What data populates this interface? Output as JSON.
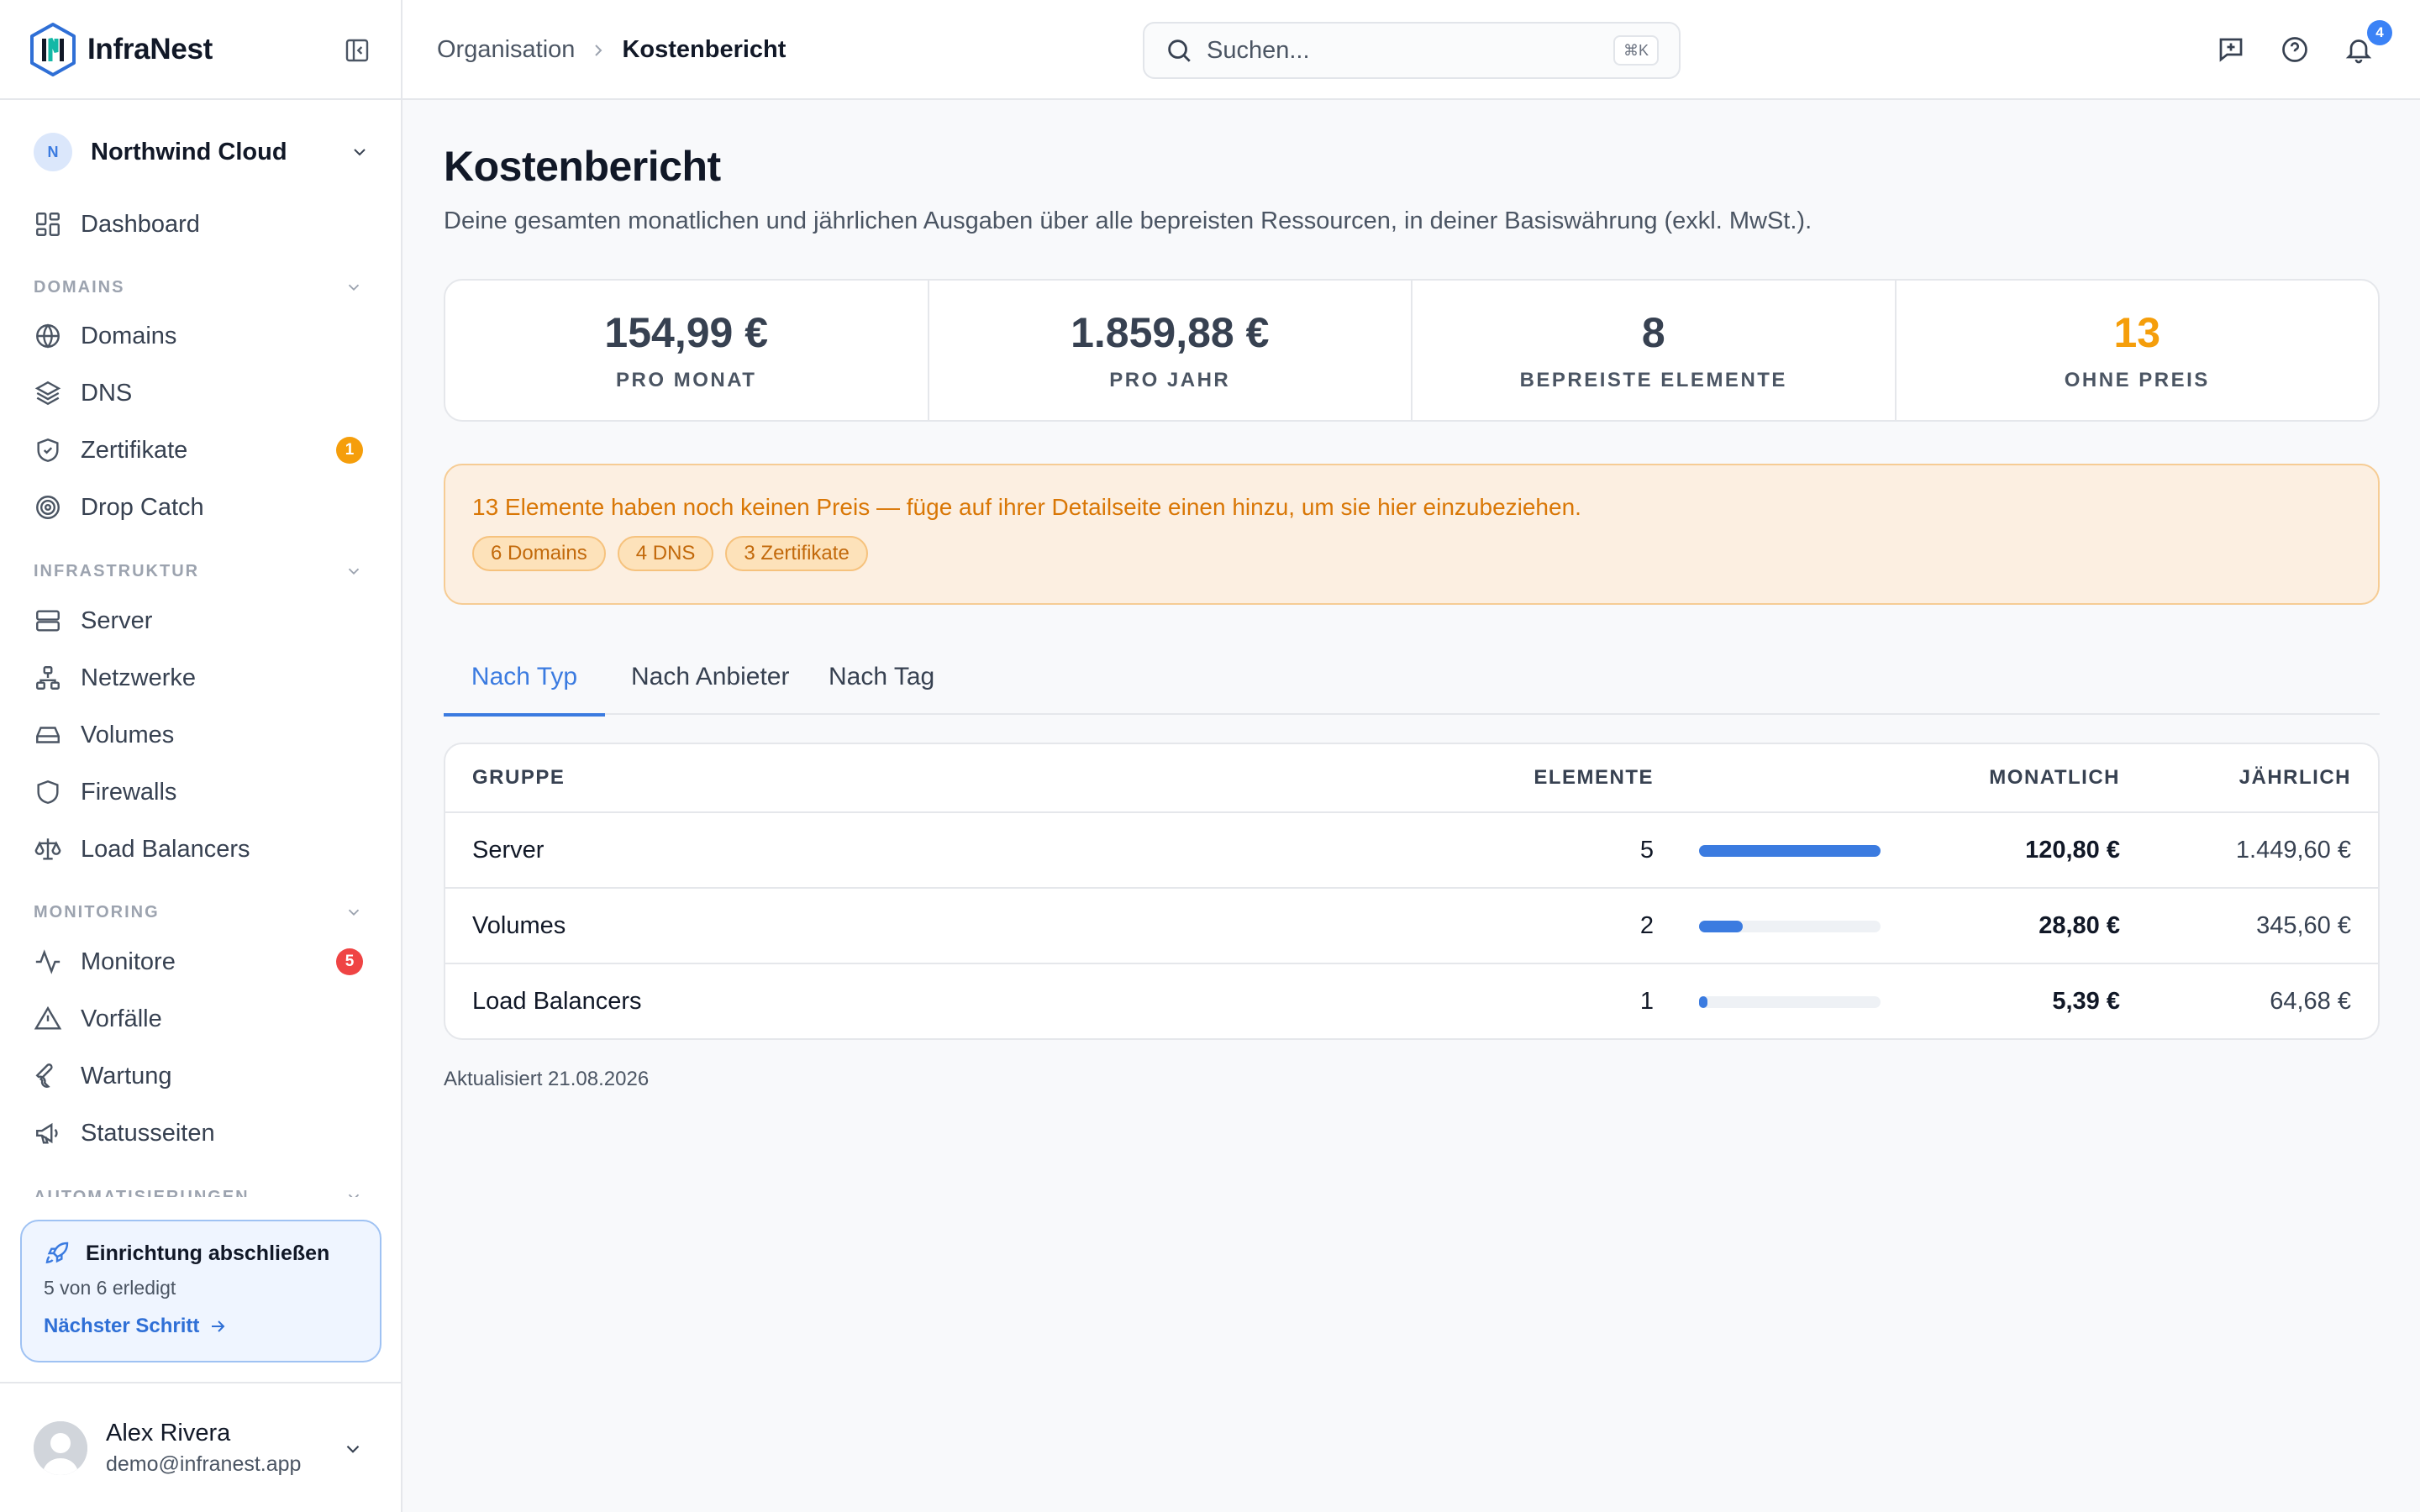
{
  "app": {
    "name": "InfraNest"
  },
  "org": {
    "initial": "N",
    "name": "Northwind Cloud"
  },
  "nav": {
    "dashboard": "Dashboard",
    "sections": {
      "domains": "DOMAINS",
      "infrastructure": "INFRASTRUKTUR",
      "monitoring": "MONITORING",
      "automation": "AUTOMATISIERUNGEN"
    },
    "items": {
      "domains": "Domains",
      "dns": "DNS",
      "certificates": "Zertifikate",
      "certificates_badge": "1",
      "dropcatch": "Drop Catch",
      "server": "Server",
      "networks": "Netzwerke",
      "volumes": "Volumes",
      "firewalls": "Firewalls",
      "loadbalancers": "Load Balancers",
      "monitors": "Monitore",
      "monitors_badge": "5",
      "incidents": "Vorfälle",
      "maintenance": "Wartung",
      "statuspages": "Statusseiten"
    }
  },
  "setup": {
    "title": "Einrichtung abschließen",
    "progress_text": "5 von 6 erledigt",
    "next": "Nächster Schritt"
  },
  "user": {
    "name": "Alex Rivera",
    "email": "demo@infranest.app"
  },
  "header": {
    "breadcrumb": {
      "parent": "Organisation",
      "current": "Kostenbericht"
    },
    "search_placeholder": "Suchen...",
    "search_shortcut": "⌘K",
    "notifications_count": "4"
  },
  "page": {
    "title": "Kostenbericht",
    "description": "Deine gesamten monatlichen und jährlichen Ausgaben über alle bepreisten Ressourcen, in deiner Basiswährung (exkl. MwSt.).",
    "stats": [
      {
        "value": "154,99 €",
        "label": "PRO MONAT"
      },
      {
        "value": "1.859,88 €",
        "label": "PRO JAHR"
      },
      {
        "value": "8",
        "label": "BEPREISTE ELEMENTE"
      },
      {
        "value": "13",
        "label": "OHNE PREIS"
      }
    ],
    "alert": {
      "text": "13 Elemente haben noch keinen Preis — füge auf ihrer Detailseite einen hinzu, um sie hier einzubeziehen.",
      "pills": [
        "6 Domains",
        "4 DNS",
        "3 Zertifikate"
      ]
    },
    "tabs": [
      "Nach Typ",
      "Nach Anbieter",
      "Nach Tag"
    ],
    "table": {
      "headers": {
        "group": "GRUPPE",
        "items": "ELEMENTE",
        "monthly": "MONATLICH",
        "yearly": "JÄHRLICH"
      },
      "rows": [
        {
          "group": "Server",
          "items": "5",
          "share": 1.0,
          "monthly": "120,80 €",
          "yearly": "1.449,60 €"
        },
        {
          "group": "Volumes",
          "items": "2",
          "share": 0.24,
          "monthly": "28,80 €",
          "yearly": "345,60 €"
        },
        {
          "group": "Load Balancers",
          "items": "1",
          "share": 0.045,
          "monthly": "5,39 €",
          "yearly": "64,68 €"
        }
      ]
    },
    "updated": "Aktualisiert 21.08.2026"
  },
  "colors": {
    "accent": "#3b7be0",
    "warning": "#f59e0b",
    "danger": "#ef4444",
    "alert_bg": "#fcefe1"
  }
}
